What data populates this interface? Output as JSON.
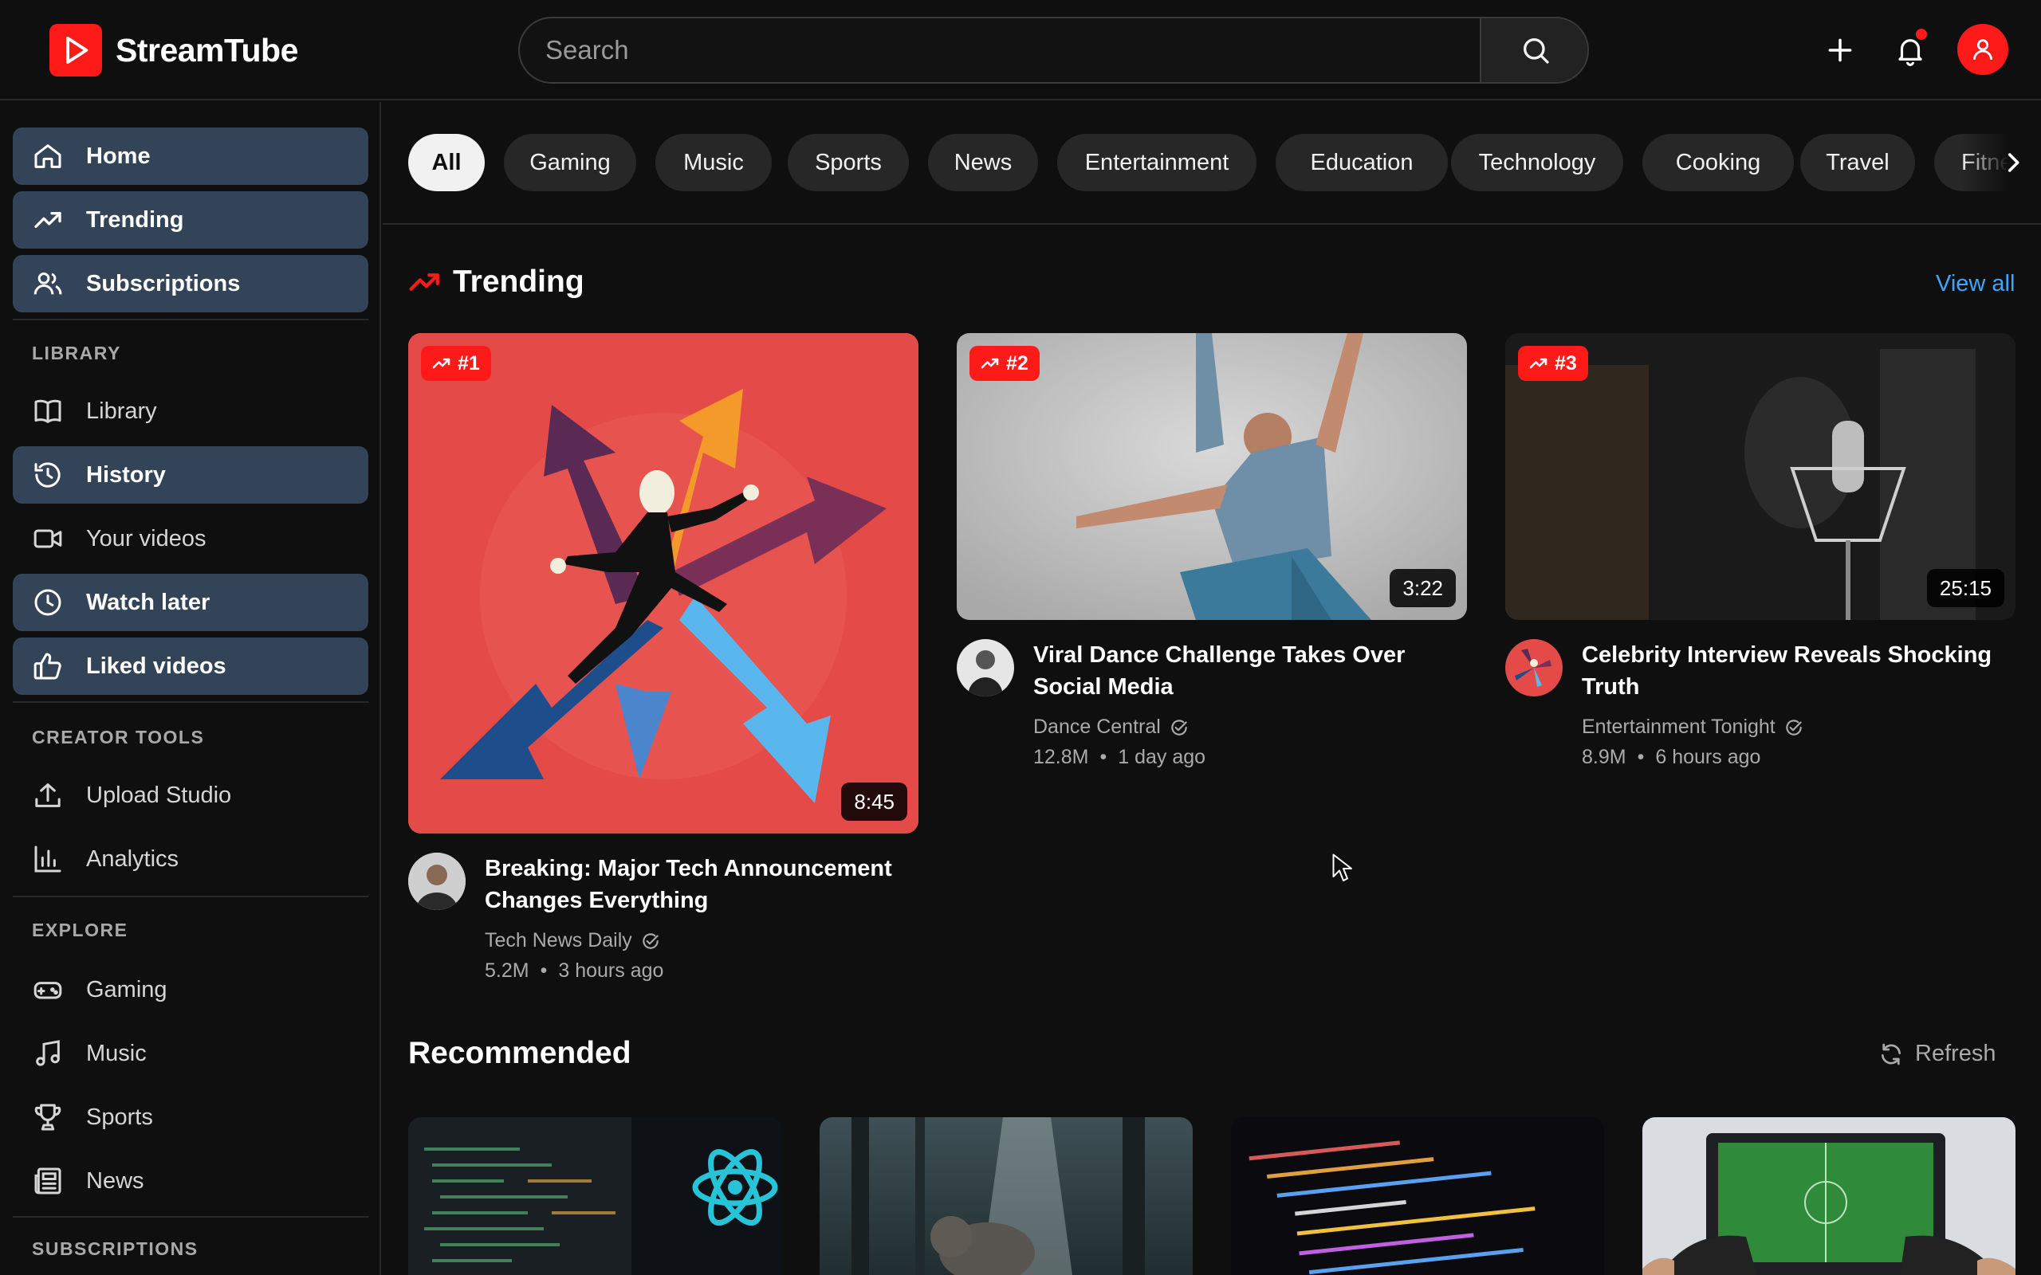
{
  "app": {
    "name": "StreamTube",
    "accent": "#ff1a1a",
    "active_nav_bg": "#334358",
    "link_color": "#3ea6ff"
  },
  "search": {
    "placeholder": "Search"
  },
  "header_icons": [
    "plus-icon",
    "bell-icon",
    "user-icon"
  ],
  "sidebar": {
    "main": [
      {
        "label": "Home",
        "icon": "home-icon",
        "active": true
      },
      {
        "label": "Trending",
        "icon": "trending-icon",
        "active": true
      },
      {
        "label": "Subscriptions",
        "icon": "users-icon",
        "active": true
      }
    ],
    "library_title": "LIBRARY",
    "library": [
      {
        "label": "Library",
        "icon": "book-icon",
        "active": false
      },
      {
        "label": "History",
        "icon": "history-icon",
        "active": true
      },
      {
        "label": "Your videos",
        "icon": "video-icon",
        "active": false
      },
      {
        "label": "Watch later",
        "icon": "clock-icon",
        "active": true
      },
      {
        "label": "Liked videos",
        "icon": "thumbs-up-icon",
        "active": true
      }
    ],
    "creator_title": "CREATOR TOOLS",
    "creator": [
      {
        "label": "Upload Studio",
        "icon": "upload-icon"
      },
      {
        "label": "Analytics",
        "icon": "bar-chart-icon"
      }
    ],
    "explore_title": "EXPLORE",
    "explore": [
      {
        "label": "Gaming",
        "icon": "gamepad-icon"
      },
      {
        "label": "Music",
        "icon": "music-icon"
      },
      {
        "label": "Sports",
        "icon": "trophy-icon"
      },
      {
        "label": "News",
        "icon": "newspaper-icon"
      }
    ],
    "subscriptions_title": "SUBSCRIPTIONS"
  },
  "chips": [
    "All",
    "Gaming",
    "Music",
    "Sports",
    "News",
    "Entertainment",
    "Education",
    "Technology",
    "Cooking",
    "Travel",
    "Fitness"
  ],
  "trending": {
    "title": "Trending",
    "view_all": "View all",
    "videos": [
      {
        "rank": "#1",
        "duration": "8:45",
        "title_line1": "Breaking: Major Tech Announcement",
        "title_line2": "Changes Everything",
        "channel": "Tech News Daily",
        "views": "5.2M",
        "age": "3 hours ago"
      },
      {
        "rank": "#2",
        "duration": "3:22",
        "title_line1": "Viral Dance Challenge Takes Over",
        "title_line2": "Social Media",
        "channel": "Dance Central",
        "views": "12.8M",
        "age": "1 day ago"
      },
      {
        "rank": "#3",
        "duration": "25:15",
        "title_line1": "Celebrity Interview Reveals Shocking",
        "title_line2": "Truth",
        "channel": "Entertainment Tonight",
        "views": "8.9M",
        "age": "6 hours ago"
      }
    ]
  },
  "recommended": {
    "title": "Recommended",
    "refresh": "Refresh"
  }
}
